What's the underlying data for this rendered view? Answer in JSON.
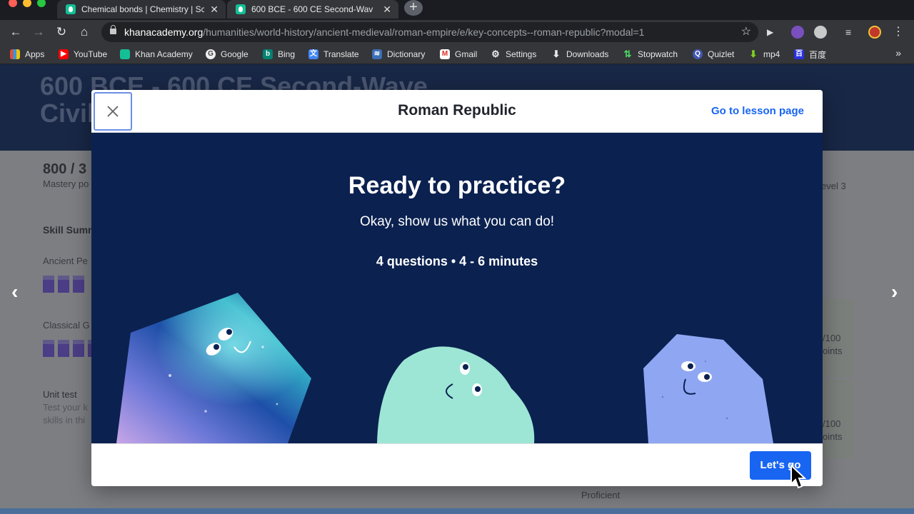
{
  "browser": {
    "tabs": [
      {
        "title": "Chemical bonds | Chemistry | Sc",
        "active": false
      },
      {
        "title": "600 BCE - 600 CE Second-Wav",
        "active": true
      }
    ],
    "new_tab": "+",
    "url": {
      "host": "khanacademy.org",
      "path": "/humanities/world-history/ancient-medieval/roman-empire/e/key-concepts--roman-republic?modal=1"
    },
    "bookmarks": [
      {
        "label": "Apps",
        "icon": "apps-grid-icon"
      },
      {
        "label": "YouTube",
        "icon": "youtube-icon"
      },
      {
        "label": "Khan Academy",
        "icon": "khan-academy-icon"
      },
      {
        "label": "Google",
        "icon": "google-icon"
      },
      {
        "label": "Bing",
        "icon": "bing-icon"
      },
      {
        "label": "Translate",
        "icon": "translate-icon"
      },
      {
        "label": "Dictionary",
        "icon": "dictionary-icon"
      },
      {
        "label": "Gmail",
        "icon": "gmail-icon"
      },
      {
        "label": "Settings",
        "icon": "gear-icon"
      },
      {
        "label": "Downloads",
        "icon": "download-icon"
      },
      {
        "label": "Stopwatch",
        "icon": "stopwatch-icon"
      },
      {
        "label": "Quizlet",
        "icon": "quizlet-icon"
      },
      {
        "label": "mp4",
        "icon": "mp4-download-icon"
      },
      {
        "label": "百度",
        "icon": "baidu-icon"
      }
    ],
    "bookmarks_more": "»"
  },
  "background_page": {
    "title_line1": "600 BCE - 600 CE Second-Wave",
    "title_line2": "Civil",
    "mastery": "800 / 3",
    "mastery_label": "Mastery po",
    "skill_summary": "Skill Summ",
    "item1": "Ancient Pe",
    "item2": "Classical G",
    "unit_test": "Unit test",
    "unit_test_desc1": "Test your k",
    "unit_test_desc2": "skills in thi",
    "level": "evel 3",
    "points1": "/100",
    "points1b": "oints",
    "points2": "/100",
    "points2b": "oints",
    "proficient": "Proficient"
  },
  "modal": {
    "title": "Roman Republic",
    "lesson_link": "Go to lesson page",
    "heading": "Ready to practice?",
    "subheading": "Okay, show us what you can do!",
    "meta": "4 questions • 4 - 6 minutes",
    "go_button": "Let's go"
  },
  "colors": {
    "modal_bg": "#0b2150",
    "accent_blue": "#1865f2",
    "shape_teal": "#9de6d5",
    "shape_periwinkle": "#8fa7f3"
  }
}
